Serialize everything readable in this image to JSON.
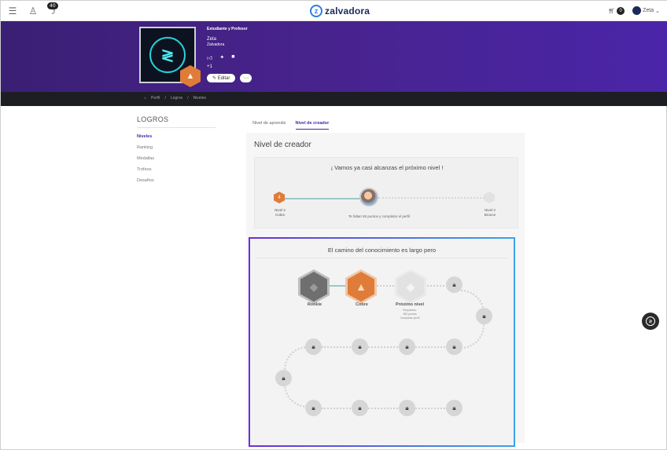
{
  "topbar": {
    "notif_count": "40",
    "brand": "zalvadora",
    "brand_mark": "z",
    "cart_count": "0",
    "user_name": "Zeta",
    "icons": [
      "menu-icon",
      "user-icon",
      "bell-icon",
      "cart-icon",
      "chevron-down-icon"
    ]
  },
  "profile": {
    "role": "Estudiante y Profesor",
    "name": "Zeta",
    "org": "Zalvadora",
    "extra": "+1",
    "edit_label": "Editar",
    "more_label": "···"
  },
  "breadcrumb": [
    "Perfil",
    "Logros",
    "Niveles"
  ],
  "sidebar": {
    "title": "LOGROS",
    "items": [
      "Niveles",
      "Ranking",
      "Medallas",
      "Trofeos",
      "Desafíos"
    ]
  },
  "tabs": [
    "Nivel de aprendiz",
    "Nivel de creador"
  ],
  "panel": {
    "title": "Nivel de creador",
    "progress_heading": "¡ Vamos ya casi alcanzas el próximo nivel !",
    "current_level": "Nivel 2\nCobre",
    "next_level": "Nivel 2\nBronce",
    "current_badge_num": "4",
    "note": "Te faltan 50 puntos y completar el perfil",
    "path_heading": "El camino del conocimiento es largo pero",
    "levels": [
      {
        "label": "Rookie"
      },
      {
        "label": "Cobre"
      },
      {
        "label": "Próximo nivel"
      }
    ],
    "next_desc": "Requisitos:\n350 puntos\nCompletar perfil"
  },
  "colors": {
    "brand_purple": "#4a25a8",
    "copper": "#e07c3a",
    "accent_blue": "#2d7fe0"
  }
}
